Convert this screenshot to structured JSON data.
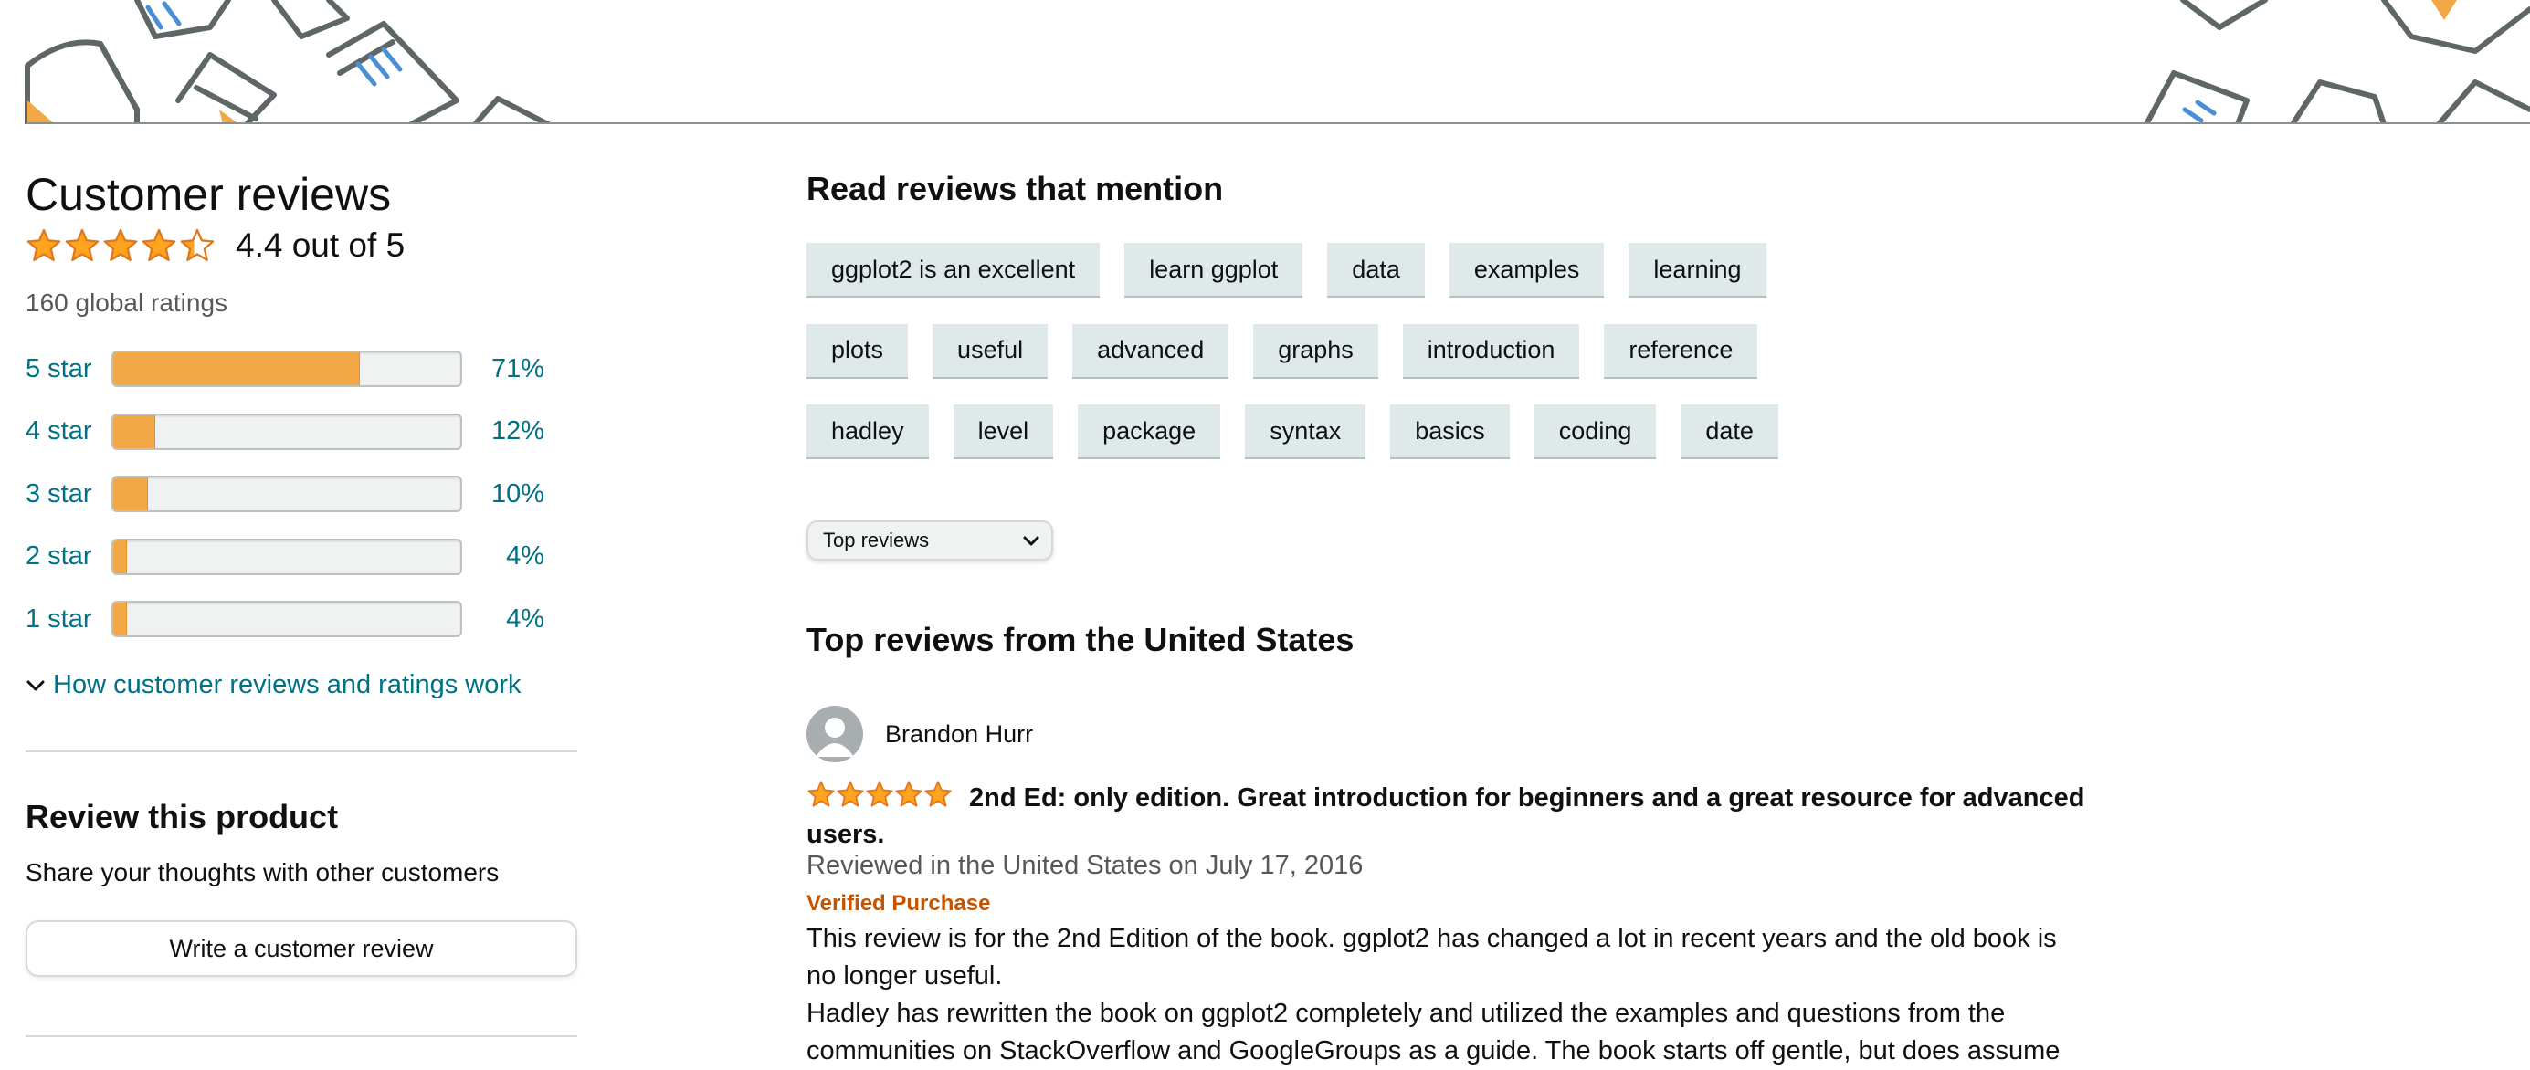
{
  "customer_reviews": {
    "title": "Customer reviews",
    "rating_text": "4.4 out of 5",
    "rating_value": 4.4,
    "global_ratings": "160 global ratings",
    "histogram": [
      {
        "label": "5 star",
        "percent_text": "71%",
        "percent": 71
      },
      {
        "label": "4 star",
        "percent_text": "12%",
        "percent": 12
      },
      {
        "label": "3 star",
        "percent_text": "10%",
        "percent": 10
      },
      {
        "label": "2 star",
        "percent_text": "4%",
        "percent": 4
      },
      {
        "label": "1 star",
        "percent_text": "4%",
        "percent": 4
      }
    ],
    "how_link": "How customer reviews and ratings work"
  },
  "review_product": {
    "title": "Review this product",
    "subtitle": "Share your thoughts with other customers",
    "button_label": "Write a customer review"
  },
  "mentions": {
    "title": "Read reviews that mention",
    "rows": [
      [
        "ggplot2 is an excellent",
        "learn ggplot",
        "data",
        "examples",
        "learning"
      ],
      [
        "plots",
        "useful",
        "advanced",
        "graphs",
        "introduction",
        "reference"
      ],
      [
        "hadley",
        "level",
        "package",
        "syntax",
        "basics",
        "coding",
        "date"
      ]
    ]
  },
  "sort": {
    "selected": "Top reviews"
  },
  "top_reviews": {
    "title": "Top reviews from the United States",
    "review": {
      "reviewer": "Brandon Hurr",
      "stars": 5,
      "title": "2nd Ed: only edition. Great introduction for beginners and a great resource for advanced users.",
      "date": "Reviewed in the United States on July 17, 2016",
      "verified": "Verified Purchase",
      "body_lines": [
        "This review is for the 2nd Edition of the book. ggplot2 has changed a lot in recent years and the old book is",
        "no longer useful.",
        "Hadley has rewritten the book on ggplot2 completely and utilized the examples and questions from the",
        "communities on StackOverflow and GoogleGroups as a guide. The book starts off gentle, but does assume"
      ]
    }
  },
  "colors": {
    "star": "#ffa41c",
    "link": "#007185",
    "bar_fill": "#f3a847",
    "verified": "#c45500",
    "tag_bg": "#dfe9ea"
  }
}
